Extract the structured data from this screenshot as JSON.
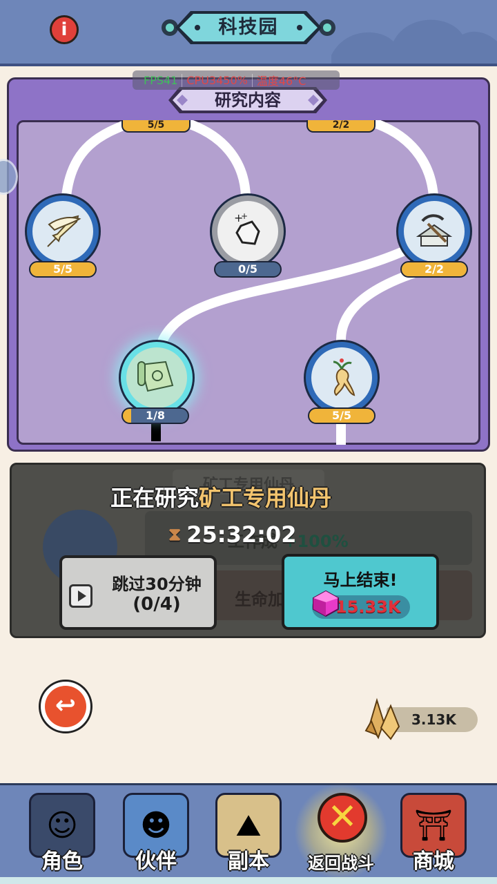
{
  "header": {
    "title": "科技园"
  },
  "perf": {
    "fps": "FPS41",
    "cpu": "CPU3450%",
    "temp": "温度46°C"
  },
  "research": {
    "section_title": "研究内容",
    "top_pills": [
      "5/5",
      "2/2"
    ],
    "nodes": [
      {
        "name": "sword",
        "icon": "sword-icon",
        "progress": "5/5",
        "fraction": 1.0
      },
      {
        "name": "ore",
        "icon": "ore-icon",
        "progress": "0/5",
        "fraction": 0.0
      },
      {
        "name": "pickaxe",
        "icon": "pickaxe-icon",
        "progress": "2/2",
        "fraction": 1.0
      },
      {
        "name": "scroll",
        "icon": "scroll-icon",
        "progress": "1/8",
        "fraction": 0.125
      },
      {
        "name": "ginseng",
        "icon": "ginseng-icon",
        "progress": "5/5",
        "fraction": 1.0
      }
    ]
  },
  "current": {
    "banner_ghost": "矿工专用仙丹",
    "prefix": "正在研究",
    "item": "矿工专用仙丹",
    "timer": "25:32:02",
    "effect_ghost": "工作",
    "effect_ghost_suffix": "成",
    "effect_ghost_bonus": "+100%",
    "effect2_ghost": "生命加",
    "skip_label": "跳过30分钟",
    "skip_count": "(0/4)",
    "finish_label": "马上结束!",
    "finish_price": "15.33K"
  },
  "currency": {
    "crystal": "3.13K"
  },
  "nav": {
    "role": "角色",
    "partner": "伙伴",
    "dungeon": "副本",
    "return_battle": "返回战斗",
    "shop": "商城"
  },
  "colors": {
    "panel_purple": "#8e73c7",
    "header_blue": "#6e86b9",
    "finish_cyan": "#4fc8cf",
    "gem_red": "#e0303a"
  }
}
